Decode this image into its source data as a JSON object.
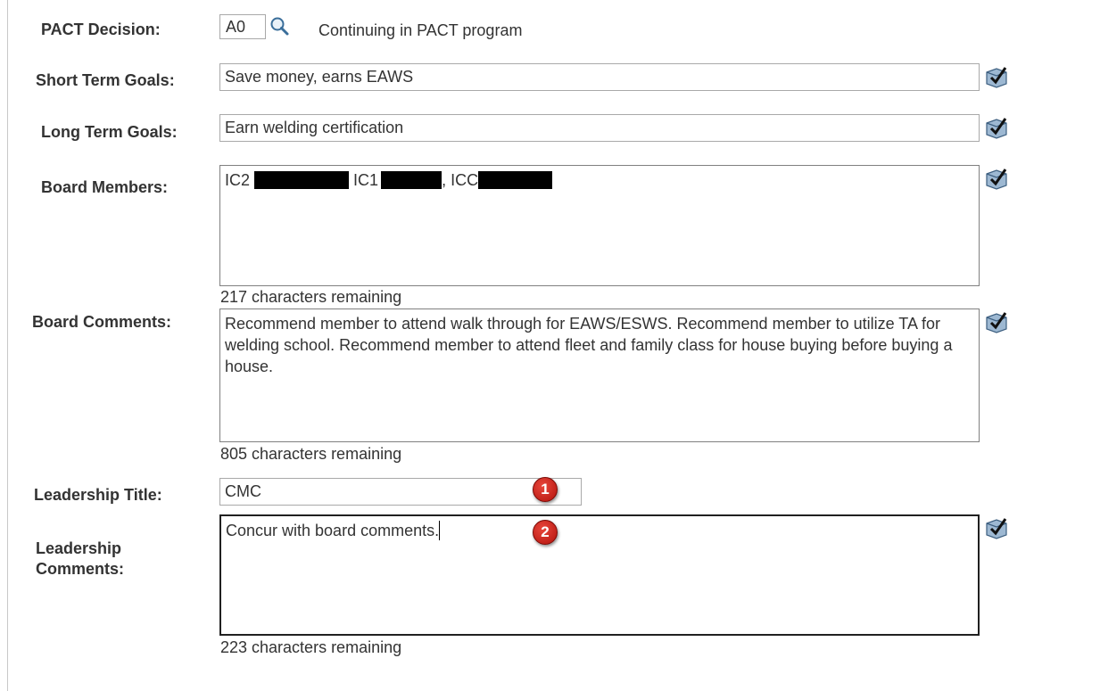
{
  "pact_decision": {
    "label": "PACT Decision:",
    "value": "A0",
    "description": "Continuing in PACT program"
  },
  "short_term_goals": {
    "label": "Short Term Goals:",
    "value": "Save money, earns EAWS"
  },
  "long_term_goals": {
    "label": "Long Term Goals:",
    "value": "Earn welding certification"
  },
  "board_members": {
    "label": "Board Members:",
    "segments": [
      "IC2",
      "IC1",
      ", ICC"
    ],
    "remaining": "217 characters remaining"
  },
  "board_comments": {
    "label": "Board Comments:",
    "value": "Recommend member to attend walk through for EAWS/ESWS. Recommend member to utilize TA for welding school. Recommend member to attend fleet and family class for house buying before buying a house.",
    "remaining": "805 characters remaining"
  },
  "leadership_title": {
    "label": "Leadership Title:",
    "value": "CMC"
  },
  "leadership_comments": {
    "label_line1": "Leadership",
    "label_line2": "Comments:",
    "value": "Concur with board comments.",
    "remaining": "223 characters remaining"
  },
  "callouts": [
    "1",
    "2"
  ],
  "icons": {
    "lookup": "magnifier-lookup-icon",
    "spellcheck": "spell-check-icon"
  }
}
